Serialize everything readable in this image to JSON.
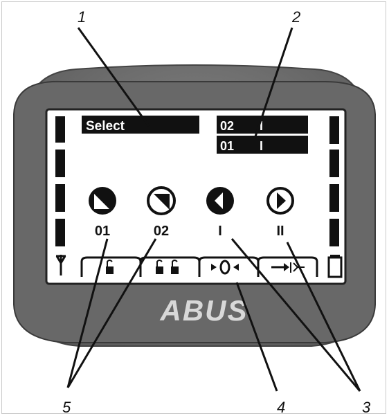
{
  "callouts": [
    "1",
    "2",
    "3",
    "4",
    "5"
  ],
  "screen": {
    "status_label": "Select",
    "rows": [
      {
        "num": "02",
        "mark": "I"
      },
      {
        "num": "01",
        "mark": "I"
      }
    ],
    "selectors": [
      {
        "icon": "corner-bottom-left-triangle-icon",
        "label": "01"
      },
      {
        "icon": "corner-top-right-triangle-icon",
        "label": "02"
      },
      {
        "icon": "arrow-left-icon",
        "label": "I"
      },
      {
        "icon": "arrow-right-icon",
        "label": "II"
      }
    ],
    "softkeys": [
      "single-lock-icon",
      "double-lock-icon",
      "crossing-arrows-icon",
      "connect-arrow-icon"
    ],
    "left_icon": "antenna-icon",
    "right_icon": "battery-icon"
  },
  "brand": "ABUS",
  "colors": {
    "housing": "#6f6f6f",
    "housing_dark": "#4a4a4a",
    "screen": "#ffffff",
    "ink": "#111111"
  }
}
